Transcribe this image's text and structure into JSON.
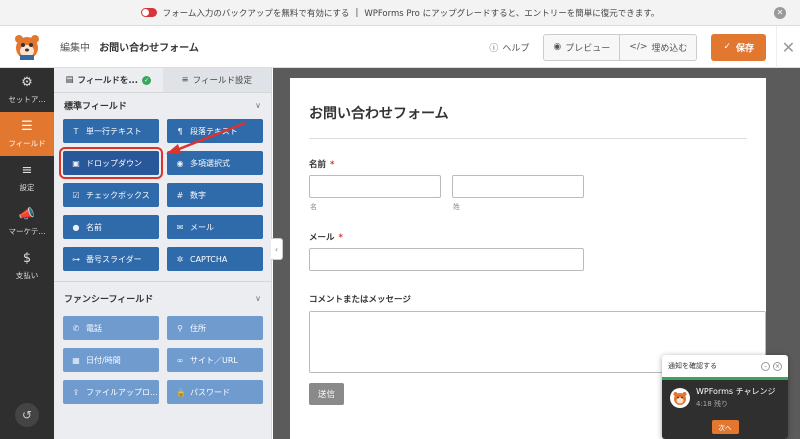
{
  "notice": {
    "text": "フォーム入力のバックアップを無料で有効にする",
    "upgrade_text": "WPForms Pro にアップグレードすると、エントリーを簡単に復元できます。"
  },
  "header": {
    "editing_label": "編集中",
    "form_name": "お問い合わせフォーム",
    "help": "ヘルプ",
    "preview": "プレビュー",
    "embed": "埋め込む",
    "save": "保存"
  },
  "leftnav": [
    {
      "label": "セットア...",
      "icon": "gear-icon"
    },
    {
      "label": "フィールド",
      "icon": "fields-icon",
      "active": true
    },
    {
      "label": "設定",
      "icon": "sliders-icon"
    },
    {
      "label": "マーケテ...",
      "icon": "megaphone-icon"
    },
    {
      "label": "支払い",
      "icon": "dollar-icon"
    }
  ],
  "panel": {
    "tab_fields": "フィールドを...",
    "tab_field_settings": "フィールド設定",
    "standard_title": "標準フィールド",
    "fancy_title": "ファンシーフィールド",
    "standard_fields": [
      {
        "label": "単一行テキスト",
        "icon": "text-icon"
      },
      {
        "label": "段落テキスト",
        "icon": "paragraph-icon"
      },
      {
        "label": "ドロップダウン",
        "icon": "dropdown-icon",
        "highlighted": true
      },
      {
        "label": "多項選択式",
        "icon": "radio-icon"
      },
      {
        "label": "チェックボックス",
        "icon": "checkbox-icon"
      },
      {
        "label": "数字",
        "icon": "hash-icon"
      },
      {
        "label": "名前",
        "icon": "person-icon"
      },
      {
        "label": "メール",
        "icon": "envelope-icon"
      },
      {
        "label": "番号スライダー",
        "icon": "slider-icon"
      },
      {
        "label": "CAPTCHA",
        "icon": "captcha-icon"
      }
    ],
    "fancy_fields": [
      {
        "label": "電話",
        "icon": "phone-icon"
      },
      {
        "label": "住所",
        "icon": "location-icon"
      },
      {
        "label": "日付/時間",
        "icon": "calendar-icon"
      },
      {
        "label": "サイト／URL",
        "icon": "link-icon"
      },
      {
        "label": "ファイルアップロ...",
        "icon": "upload-icon"
      },
      {
        "label": "パスワード",
        "icon": "lock-icon"
      }
    ]
  },
  "form": {
    "title": "お問い合わせフォーム",
    "name_label": "名前",
    "first_sub": "名",
    "last_sub": "姓",
    "email_label": "メール",
    "message_label": "コメントまたはメッセージ",
    "required_mark": "*",
    "submit": "送信"
  },
  "challenge": {
    "header": "通知を確認する",
    "title": "WPForms チャレンジ",
    "time": "4:18 残り",
    "next": "次へ"
  },
  "colors": {
    "accent": "#e27730",
    "field_button": "#2f6aab",
    "fancy_button": "#6f9bcf",
    "highlight": "#e0322d"
  }
}
